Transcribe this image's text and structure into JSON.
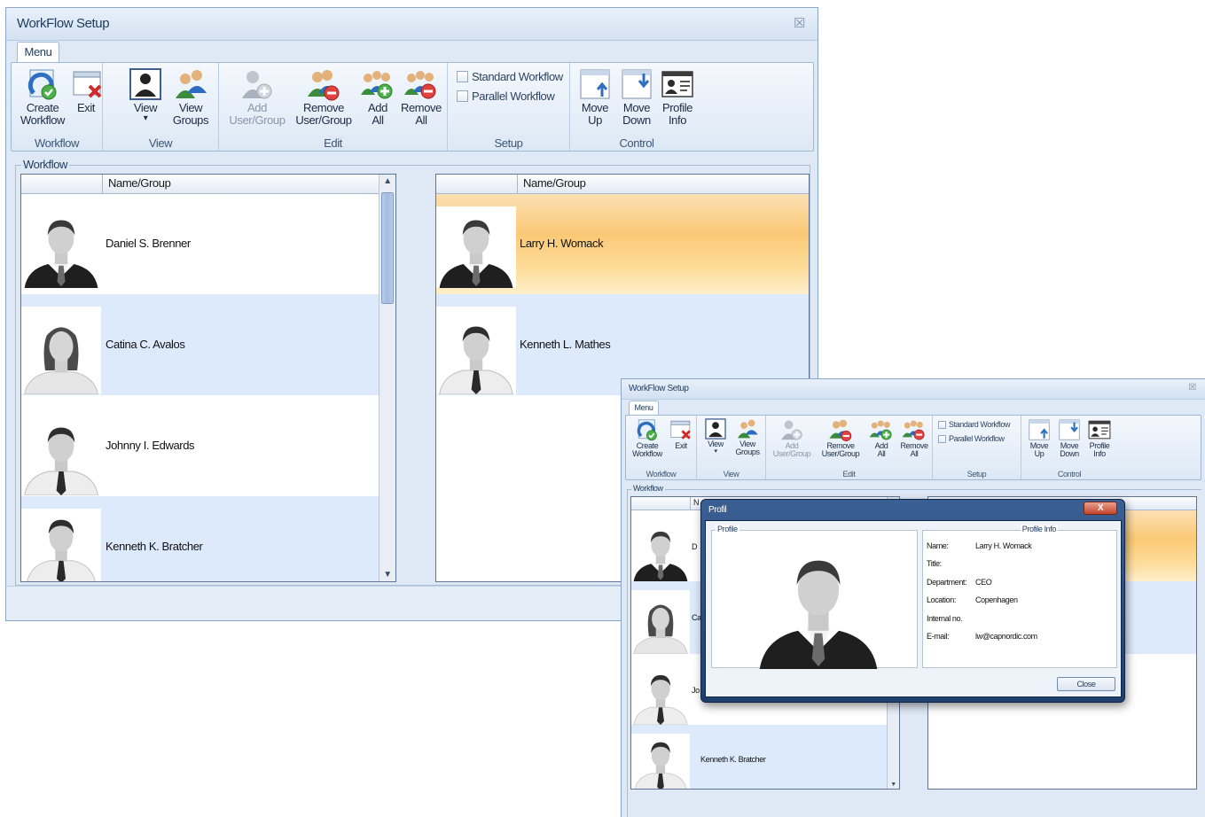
{
  "window": {
    "title": "WorkFlow Setup",
    "close_glyph": "☒",
    "menu_tab": "Menu"
  },
  "ribbon": {
    "groups": [
      {
        "label": "Workflow"
      },
      {
        "label": "View"
      },
      {
        "label": "Edit"
      },
      {
        "label": "Setup"
      },
      {
        "label": "Control"
      }
    ],
    "create_workflow": [
      "Create",
      "Workflow"
    ],
    "exit": [
      "Exit"
    ],
    "view": [
      "View",
      "▾"
    ],
    "view_groups": [
      "View",
      "Groups"
    ],
    "add_user_group": [
      "Add",
      "User/Group"
    ],
    "remove_user_group": [
      "Remove",
      "User/Group"
    ],
    "add_all": [
      "Add",
      "All"
    ],
    "remove_all": [
      "Remove",
      "All"
    ],
    "standard_workflow": "Standard Workflow",
    "parallel_workflow": "Parallel Workflow",
    "move_up": [
      "Move",
      "Up"
    ],
    "move_down": [
      "Move",
      "Down"
    ],
    "profile_info": [
      "Profile",
      "Info"
    ]
  },
  "workflow_frame": {
    "legend": "Workflow"
  },
  "left_list": {
    "header": "Name/Group",
    "rows": [
      {
        "name": "Daniel S. Brenner"
      },
      {
        "name": "Catina C. Avalos"
      },
      {
        "name": "Johnny I. Edwards"
      },
      {
        "name": "Kenneth K. Bratcher"
      }
    ]
  },
  "right_list": {
    "header": "Name/Group",
    "rows": [
      {
        "name": "Larry H. Womack"
      },
      {
        "name": "Kenneth L. Mathes"
      }
    ]
  },
  "profile_dialog": {
    "title": "Profil",
    "close_glyph": "X",
    "profile_legend": "Profile",
    "info_legend": "Profile Info",
    "fields": [
      {
        "key": "Name:",
        "value": "Larry H. Womack"
      },
      {
        "key": "Title:",
        "value": ""
      },
      {
        "key": "Department:",
        "value": "CEO"
      },
      {
        "key": "Location:",
        "value": "Copenhagen"
      },
      {
        "key": "Internal no.",
        "value": ""
      },
      {
        "key": "E-mail:",
        "value": "lw@capnordic.com"
      }
    ],
    "close_button": "Close"
  },
  "second_left_list": {
    "header_fragment": "N",
    "rows": [
      {
        "name_fragment": "D"
      },
      {
        "name_fragment": "Ca"
      },
      {
        "name_fragment": "Jo"
      },
      {
        "name": "Kenneth K. Bratcher"
      }
    ]
  },
  "icons": {
    "create_workflow": "create-workflow-icon",
    "exit": "exit-icon",
    "view": "view-user-icon",
    "view_groups": "view-groups-icon",
    "add_user_group": "add-user-icon",
    "remove_user_group": "remove-user-icon",
    "add_all": "add-all-icon",
    "remove_all": "remove-all-icon",
    "move_up": "move-up-icon",
    "move_down": "move-down-icon",
    "profile_info": "profile-info-icon"
  }
}
